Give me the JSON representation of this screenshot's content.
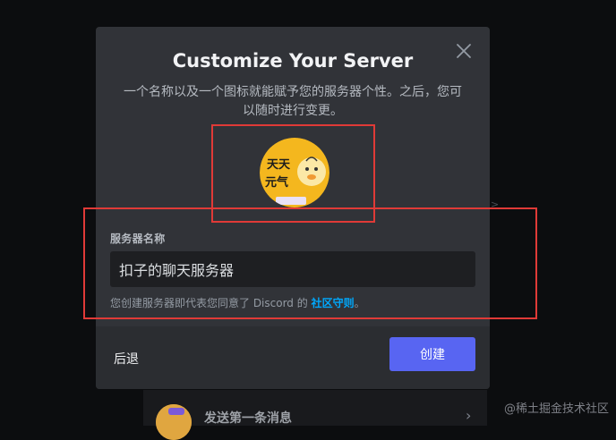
{
  "modal": {
    "title": "Customize Your Server",
    "subtitle": "一个名称以及一个图标就能赋予您的服务器个性。之后，您可以随时进行变更。",
    "server_name_label": "服务器名称",
    "server_name_value": "扣子的聊天服务器",
    "terms_prefix": "您创建服务器即代表您同意了 Discord 的 ",
    "terms_link": "社区守则",
    "terms_suffix": "。",
    "back_label": "后退",
    "create_label": "创建",
    "close_icon": "close-icon"
  },
  "avatar": {
    "image": "server-icon-image",
    "line1": "天天",
    "line2": "元气"
  },
  "behind": {
    "message_text": "发送第一条消息",
    "chevron": "›"
  },
  "watermark": "@稀土掘金技术社区",
  "colors": {
    "modal_bg": "#313338",
    "footer_bg": "#2b2d31",
    "input_bg": "#1e1f22",
    "accent": "#5865f2",
    "link": "#00a8fc",
    "highlight": "#e03a37"
  }
}
